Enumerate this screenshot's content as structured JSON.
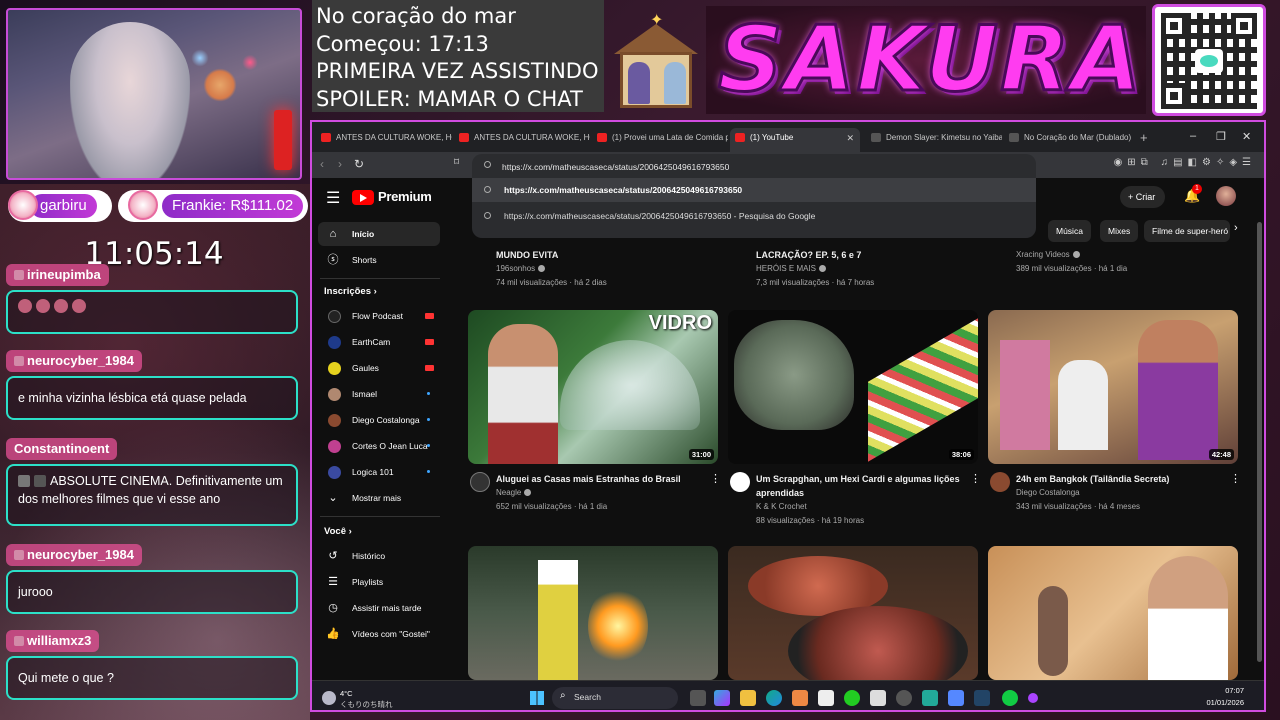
{
  "overlay": {
    "info_lines": [
      "No coração do mar",
      "Começou: 17:13",
      "PRIMEIRA VEZ ASSISTINDO",
      "SPOILER: MAMAR O CHAT"
    ],
    "banner": "SAKURA",
    "clock": "11:05:14",
    "sub_left": "garbiru",
    "sub_right": "Frankie: R$111.02"
  },
  "chat": [
    {
      "user": "irineupimba",
      "message": ""
    },
    {
      "user": "neurocyber_1984",
      "message": "e minha vizinha lésbica etá quase pelada"
    },
    {
      "user": "Constantinoent",
      "message": "ABSOLUTE CINEMA. Definitivamente um dos melhores filmes que vi esse ano"
    },
    {
      "user": "neurocyber_1984",
      "message": "jurooo"
    },
    {
      "user": "williamxz3",
      "message": "Qui mete o que ?"
    }
  ],
  "browser": {
    "tabs": [
      {
        "label": "ANTES DA CULTURA WOKE, HOLL"
      },
      {
        "label": "ANTES DA CULTURA WOKE, HOLL"
      },
      {
        "label": "(1) Provei uma Lata de Comida pa"
      },
      {
        "label": "(1) YouTube"
      },
      {
        "label": "Demon Slayer: Kimetsu no Yaiba ("
      },
      {
        "label": "No Coração do Mar (Dublado)"
      }
    ],
    "url": "https://x.com/matheuscaseca/status/2006425049616793650",
    "suggestions": [
      "https://x.com/matheuscaseca/status/2006425049616793650",
      "https://x.com/matheuscaseca/status/2006425049616793650 - Pesquisa do Google"
    ]
  },
  "youtube": {
    "logo": "Premium",
    "create_label": "Criar",
    "notifications": "1",
    "sidebar": {
      "main": [
        {
          "label": "Início",
          "icon": "home-icon"
        },
        {
          "label": "Shorts",
          "icon": "shorts-icon"
        }
      ],
      "subs_header": "Inscrições",
      "subs": [
        {
          "label": "Flow Podcast",
          "status": "live"
        },
        {
          "label": "EarthCam",
          "status": "live"
        },
        {
          "label": "Gaules",
          "status": "live"
        },
        {
          "label": "Ismael",
          "status": "new"
        },
        {
          "label": "Diego Costalonga",
          "status": "new"
        },
        {
          "label": "Cortes O Jean Luca",
          "status": "new"
        },
        {
          "label": "Logica 101",
          "status": "new"
        }
      ],
      "show_more": "Mostrar mais",
      "you_header": "Você",
      "you": [
        {
          "label": "Histórico",
          "icon": "history-icon"
        },
        {
          "label": "Playlists",
          "icon": "playlists-icon"
        },
        {
          "label": "Assistir mais tarde",
          "icon": "watch-later-icon"
        },
        {
          "label": "Vídeos com \"Gostei\"",
          "icon": "like-icon"
        }
      ]
    },
    "chips": [
      "Música",
      "Mixes",
      "Filme de super-heró"
    ],
    "partial_row": [
      {
        "title": "MUNDO EVITA",
        "channel": "196sonhos",
        "meta": "74 mil visualizações · há 2 dias"
      },
      {
        "title": "LACRAÇÃO? EP. 5, 6 e 7",
        "channel": "HERÓIS E MAIS",
        "meta": "7,3 mil visualizações · há 7 horas"
      },
      {
        "title": "",
        "channel": "Xracing Videos",
        "meta": "389 mil visualizações · há 1 dia"
      }
    ],
    "videos": [
      {
        "title": "Aluguei as Casas mais Estranhas do Brasil",
        "channel": "Neagle",
        "meta": "652 mil visualizações · há 1 dia",
        "duration": "31:00",
        "thumb_text": "VIDRO"
      },
      {
        "title": "Um Scrapghan, um Hexi Cardi e algumas lições aprendidas",
        "channel": "K & K Crochet",
        "meta": "88 visualizações · há 19 horas",
        "duration": "38:06"
      },
      {
        "title": "24h em Bangkok (Tailândia Secreta)",
        "channel": "Diego Costalonga",
        "meta": "343 mil visualizações · há 4 meses",
        "duration": "42:48"
      }
    ]
  },
  "taskbar": {
    "temp": "4°C",
    "condition": "くもりのち晴れ",
    "search": "Search",
    "time": "07:07",
    "date": "01/01/2026"
  },
  "colors": {
    "accent": "#d04ce0",
    "chat_border": "#2ce0c8",
    "yt_red": "#ff0000"
  }
}
